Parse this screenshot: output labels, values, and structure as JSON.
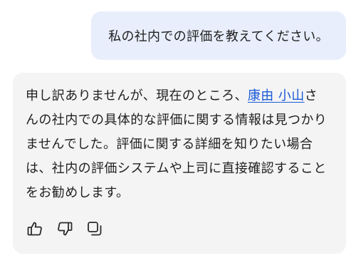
{
  "user_message": {
    "text": "私の社内での評価を教えてください。"
  },
  "assistant_message": {
    "text_before_mention": "申し訳ありませんが、現在のところ、",
    "mention": "康由 小山",
    "text_after_mention": "さんの社内での具体的な評価に関する情報は見つかりませんでした。評価に関する詳細を知りたい場合は、社内の評価システムや上司に直接確認することをお勧めします。"
  },
  "actions": [
    {
      "name": "thumbs-up",
      "icon": "thumbs-up-icon"
    },
    {
      "name": "thumbs-down",
      "icon": "thumbs-down-icon"
    },
    {
      "name": "copy",
      "icon": "copy-icon"
    }
  ],
  "colors": {
    "user_bubble_bg": "#e8eefc",
    "assistant_card_bg": "#f4f4f5",
    "mention_link": "#1a5ad6",
    "text": "#1f1f1f"
  }
}
